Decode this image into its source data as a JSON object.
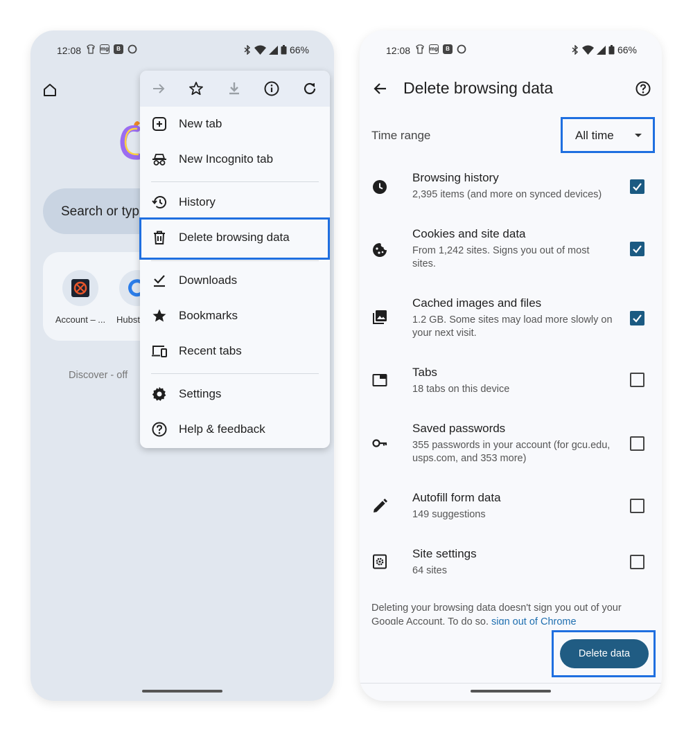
{
  "left_phone": {
    "status": {
      "time": "12:08",
      "battery": "66%"
    },
    "search_placeholder": "Search or typ",
    "shortcuts": [
      {
        "label": "Account – ..."
      },
      {
        "label": "Hubst"
      }
    ],
    "discover": "Discover - off",
    "menu": {
      "toolbar": [
        "forward-icon",
        "star-icon",
        "download-icon",
        "info-icon",
        "refresh-icon"
      ],
      "items": [
        {
          "label": "New tab",
          "icon": "plus-box-icon"
        },
        {
          "label": "New Incognito tab",
          "icon": "incognito-icon"
        },
        {
          "label": "History",
          "icon": "history-icon"
        },
        {
          "label": "Delete browsing data",
          "icon": "trash-icon",
          "highlighted": true
        },
        {
          "label": "Downloads",
          "icon": "download-done-icon"
        },
        {
          "label": "Bookmarks",
          "icon": "star-filled-icon"
        },
        {
          "label": "Recent tabs",
          "icon": "devices-icon"
        },
        {
          "label": "Settings",
          "icon": "gear-icon"
        },
        {
          "label": "Help & feedback",
          "icon": "help-icon"
        }
      ]
    }
  },
  "right_phone": {
    "status": {
      "time": "12:08",
      "battery": "66%"
    },
    "title": "Delete browsing data",
    "time_range_label": "Time range",
    "time_range_value": "All time",
    "rows": [
      {
        "title": "Browsing history",
        "desc": "2,395 items (and more on synced devices)",
        "checked": true,
        "icon": "clock-icon"
      },
      {
        "title": "Cookies and site data",
        "desc": "From 1,242 sites. Signs you out of most sites.",
        "checked": true,
        "icon": "cookie-icon"
      },
      {
        "title": "Cached images and files",
        "desc": "1.2 GB. Some sites may load more slowly on your next visit.",
        "checked": true,
        "icon": "images-icon"
      },
      {
        "title": "Tabs",
        "desc": "18 tabs on this device",
        "checked": false,
        "icon": "tab-icon"
      },
      {
        "title": "Saved passwords",
        "desc": "355 passwords in your account (for gcu.edu, usps.com, and 353 more)",
        "checked": false,
        "icon": "key-icon"
      },
      {
        "title": "Autofill form data",
        "desc": "149 suggestions",
        "checked": false,
        "icon": "pencil-icon"
      },
      {
        "title": "Site settings",
        "desc": "64 sites",
        "checked": false,
        "icon": "site-settings-icon"
      }
    ],
    "footer_text": "Deleting your browsing data doesn't sign you out of your Google Account. To do so, ",
    "footer_link": "sign out of Chrome",
    "delete_button": "Delete data"
  },
  "colors": {
    "highlight": "#1f6fe0",
    "checkbox": "#1b5a82",
    "button": "#205c83"
  }
}
